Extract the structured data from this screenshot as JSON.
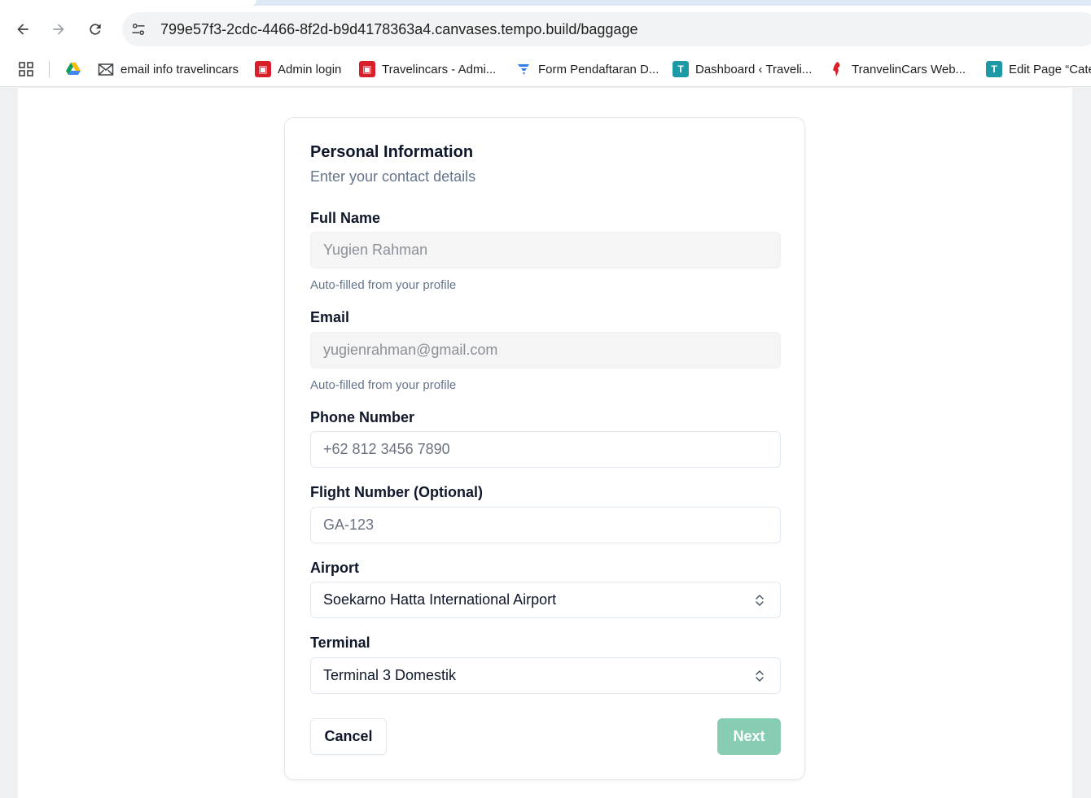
{
  "browser": {
    "url_full": "799e57f3-2cdc-4466-8f2d-b9d4178363a4.canvases.tempo.build/baggage",
    "bookmarks": [
      {
        "label": "",
        "icon": "google-drive-icon"
      },
      {
        "label": "email info travelincars",
        "icon": "mail-icon"
      },
      {
        "label": "Admin login",
        "icon": "app-red-icon"
      },
      {
        "label": "Travelincars - Admi...",
        "icon": "app-red-icon"
      },
      {
        "label": "Form Pendaftaran D...",
        "icon": "form-icon"
      },
      {
        "label": "Dashboard ‹ Traveli...",
        "icon": "t-icon"
      },
      {
        "label": "TranvelinCars Web...",
        "icon": "wolf-icon"
      },
      {
        "label": "Edit Page “Cate",
        "icon": "t-icon"
      }
    ]
  },
  "form": {
    "title": "Personal Information",
    "subtitle": "Enter your contact details",
    "full_name": {
      "label": "Full Name",
      "value": "Yugien Rahman",
      "hint": "Auto-filled from your profile"
    },
    "email": {
      "label": "Email",
      "value": "yugienrahman@gmail.com",
      "hint": "Auto-filled from your profile"
    },
    "phone": {
      "label": "Phone Number",
      "placeholder": "+62 812 3456 7890"
    },
    "flight": {
      "label": "Flight Number (Optional)",
      "placeholder": "GA-123"
    },
    "airport": {
      "label": "Airport",
      "value": "Soekarno Hatta International Airport"
    },
    "terminal": {
      "label": "Terminal",
      "value": "Terminal 3 Domestik"
    },
    "cancel_label": "Cancel",
    "next_label": "Next"
  },
  "colors": {
    "next_button": "#86cdb4",
    "text_primary": "#0f172a",
    "text_muted": "#64748b"
  }
}
